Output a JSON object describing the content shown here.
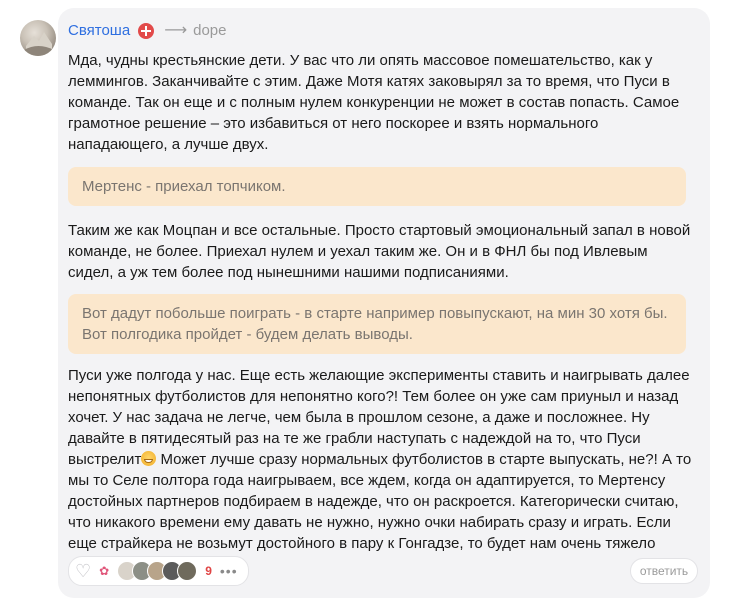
{
  "comment": {
    "author": "Святоша",
    "reply_to": "dope",
    "paragraph1": "Мда, чудны крестьянские дети. У вас что ли опять массовое помешательство, как у леммингов. Заканчивайте с этим. Даже Мотя катях заковырял за то время, что Пуси в команде. Так он еще и с полным нулем конкуренции не может в состав попасть. Самое грамотное решение – это избавиться от него поскорее и взять нормального нападающего, а лучше двух.",
    "quote1": "Мертенс - приехал топчиком.",
    "paragraph2": "Таким же как Моцпан и все остальные. Просто стартовый эмоциональный запал в новой команде, не более. Приехал нулем и уехал таким же. Он и в ФНЛ бы под Ивлевым сидел, а уж тем более под нынешними нашими подписаниями.",
    "quote2": "Вот дадут побольше поиграть - в старте например повыпускают, на мин 30 хотя бы. Вот полгодика пройдет - будем делать выводы.",
    "paragraph3_before": "Пуси уже полгода у нас. Еще есть желающие эксперименты ставить и наигрывать далее непонятных футболистов для непонятно кого?! Тем более он уже сам приуныл и назад хочет. У нас задача не легче, чем была в прошлом сезоне, а даже и посложнее. Ну давайте в пятидесятый раз на те же грабли наступать с надеждой на то, что Пуси выстрелит",
    "paragraph3_after": " Может лучше сразу нормальных футболистов в старте выпускать, не?! А то мы то Селе полтора года наигрываем, все ждем, когда он адаптируется, то Мертенсу достойных партнеров подбираем в надежде, что он раскроется. Категорически считаю, что никакого времени ему давать не нужно, нужно очки набирать сразу и играть. Если еще страйкера не возьмут достойного в пару к Гонгадзе, то будет нам очень тяжело",
    "reactions_count": "9",
    "more_label": "•••",
    "reply_label": "ответить"
  },
  "icons": {
    "badge": "red-cross-badge-icon",
    "arrow": "reply-arrow-icon",
    "like": "heart-icon",
    "emoji": "grinning-face-emoji"
  },
  "colors": {
    "author": "#2f6fe0",
    "card_bg": "#f3f3f5",
    "quote_bg": "#fbe7cc",
    "count": "#e04444"
  }
}
